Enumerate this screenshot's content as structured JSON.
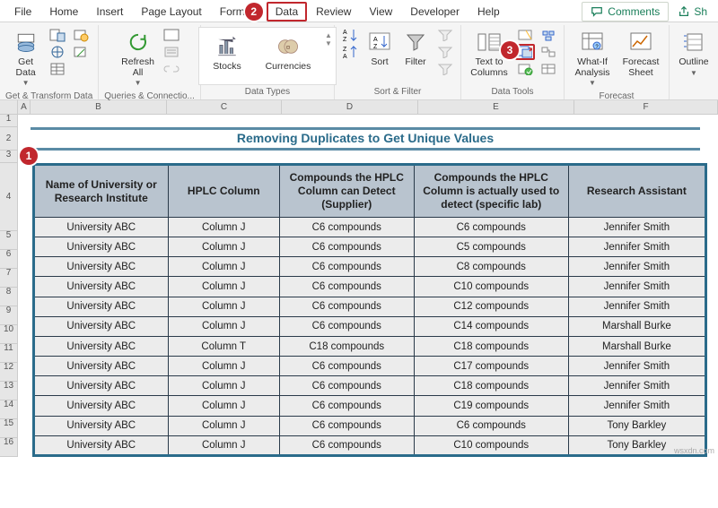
{
  "tabs": {
    "file": "File",
    "home": "Home",
    "insert": "Insert",
    "page_layout": "Page Layout",
    "formulas": "Formulas",
    "data": "Data",
    "review": "Review",
    "view": "View",
    "developer": "Developer",
    "help": "Help"
  },
  "active_tab": "data",
  "comments_label": "Comments",
  "share_label": "Sh",
  "ribbon": {
    "get_data": "Get Data",
    "get_transform_group": "Get & Transform Data",
    "refresh_all": "Refresh All",
    "queries_group": "Queries & Connectio...",
    "stocks": "Stocks",
    "currencies": "Currencies",
    "data_types_group": "Data Types",
    "sort": "Sort",
    "filter": "Filter",
    "sort_filter_group": "Sort & Filter",
    "text_to_columns": "Text to Columns",
    "data_tools_group": "Data Tools",
    "whatif": "What-If Analysis",
    "forecast_sheet": "Forecast Sheet",
    "forecast_group": "Forecast",
    "outline": "Outline"
  },
  "callouts": {
    "c1": "1",
    "c2": "2",
    "c3": "3"
  },
  "col_letters": [
    "A",
    "B",
    "C",
    "D",
    "E",
    "F"
  ],
  "row_numbers": [
    "1",
    "2",
    "3",
    "4",
    "5",
    "6",
    "7",
    "8",
    "9",
    "10",
    "11",
    "12",
    "13",
    "14",
    "15",
    "16"
  ],
  "title": "Removing Duplicates to Get Unique Values",
  "table": {
    "headers": {
      "h1": "Name of University or Research Institute",
      "h2": "HPLC Column",
      "h3": "Compounds the HPLC Column can Detect (Supplier)",
      "h4": "Compounds the HPLC Column is actually used to detect (specific lab)",
      "h5": "Research Assistant"
    },
    "rows": [
      {
        "c1": "University ABC",
        "c2": "Column J",
        "c3": "C6 compounds",
        "c4": "C6 compounds",
        "c5": "Jennifer Smith"
      },
      {
        "c1": "University ABC",
        "c2": "Column J",
        "c3": "C6 compounds",
        "c4": "C5 compounds",
        "c5": "Jennifer Smith"
      },
      {
        "c1": "University ABC",
        "c2": "Column J",
        "c3": "C6 compounds",
        "c4": "C8 compounds",
        "c5": "Jennifer Smith"
      },
      {
        "c1": "University ABC",
        "c2": "Column J",
        "c3": "C6 compounds",
        "c4": "C10 compounds",
        "c5": "Jennifer Smith"
      },
      {
        "c1": "University ABC",
        "c2": "Column J",
        "c3": "C6 compounds",
        "c4": "C12 compounds",
        "c5": "Jennifer Smith"
      },
      {
        "c1": "University ABC",
        "c2": "Column J",
        "c3": "C6 compounds",
        "c4": "C14 compounds",
        "c5": "Marshall Burke"
      },
      {
        "c1": "University ABC",
        "c2": "Column T",
        "c3": "C18 compounds",
        "c4": "C18 compounds",
        "c5": "Marshall Burke"
      },
      {
        "c1": "University ABC",
        "c2": "Column J",
        "c3": "C6 compounds",
        "c4": "C17 compounds",
        "c5": "Jennifer Smith"
      },
      {
        "c1": "University ABC",
        "c2": "Column J",
        "c3": "C6 compounds",
        "c4": "C18 compounds",
        "c5": "Jennifer Smith"
      },
      {
        "c1": "University ABC",
        "c2": "Column J",
        "c3": "C6 compounds",
        "c4": "C19 compounds",
        "c5": "Jennifer Smith"
      },
      {
        "c1": "University ABC",
        "c2": "Column J",
        "c3": "C6 compounds",
        "c4": "C6 compounds",
        "c5": "Tony Barkley"
      },
      {
        "c1": "University ABC",
        "c2": "Column J",
        "c3": "C6 compounds",
        "c4": "C10 compounds",
        "c5": "Tony Barkley"
      }
    ]
  },
  "watermark": "wsxdn.com"
}
